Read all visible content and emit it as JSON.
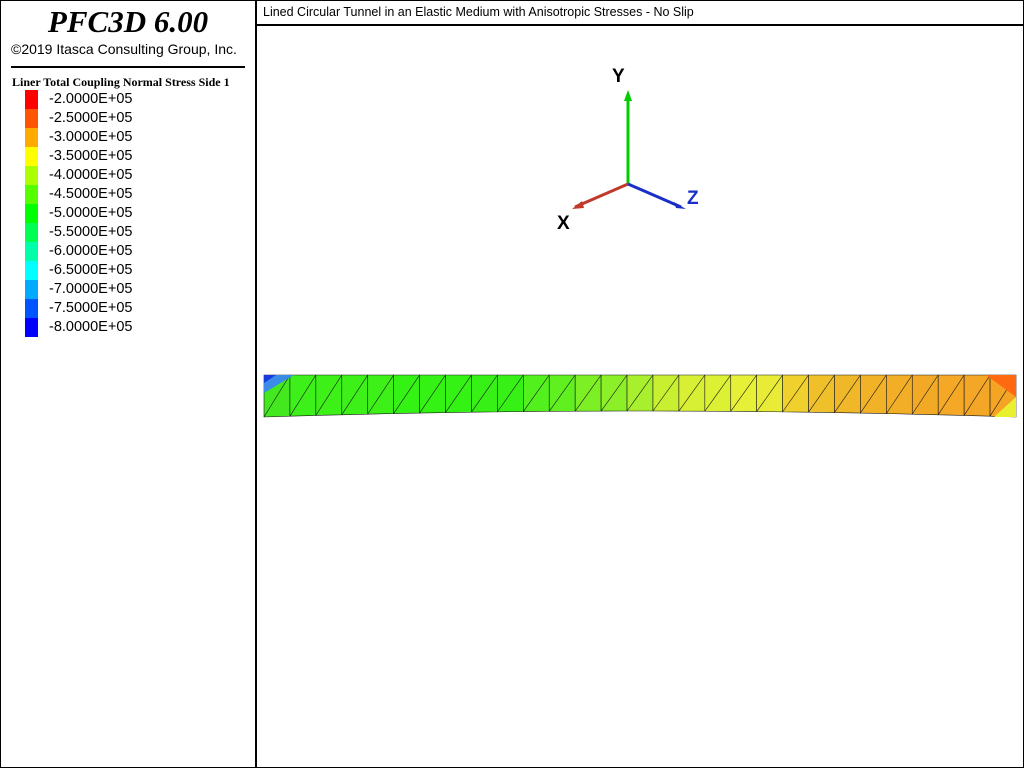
{
  "app": {
    "title": "PFC3D 6.00",
    "copyright": "©2019 Itasca Consulting Group, Inc."
  },
  "legend": {
    "title": "Liner Total Coupling Normal Stress Side 1",
    "items": [
      {
        "label": "-2.0000E+05",
        "color": "#ff0000"
      },
      {
        "label": "-2.5000E+05",
        "color": "#ff5500"
      },
      {
        "label": "-3.0000E+05",
        "color": "#ffaa00"
      },
      {
        "label": "-3.5000E+05",
        "color": "#ffff00"
      },
      {
        "label": "-4.0000E+05",
        "color": "#aaff00"
      },
      {
        "label": "-4.5000E+05",
        "color": "#55ff00"
      },
      {
        "label": "-5.0000E+05",
        "color": "#00ff00"
      },
      {
        "label": "-5.5000E+05",
        "color": "#00ff55"
      },
      {
        "label": "-6.0000E+05",
        "color": "#00ffaa"
      },
      {
        "label": "-6.5000E+05",
        "color": "#00ffff"
      },
      {
        "label": "-7.0000E+05",
        "color": "#00aaff"
      },
      {
        "label": "-7.5000E+05",
        "color": "#0055ff"
      },
      {
        "label": "-8.0000E+05",
        "color": "#0000ff"
      }
    ]
  },
  "plot": {
    "title": "Lined Circular Tunnel in an Elastic Medium with Anisotropic Stresses - No Slip"
  },
  "axes": {
    "x_label": "X",
    "y_label": "Y",
    "z_label": "Z",
    "x_color": "#c0392b",
    "y_color": "#00cc00",
    "z_color": "#1a2fc8"
  },
  "liner_colors": [
    "#44e81e",
    "#3ef01a",
    "#3cf018",
    "#3cf018",
    "#3cf018",
    "#34f214",
    "#34f214",
    "#34f214",
    "#36f016",
    "#36f016",
    "#52f01c",
    "#60f020",
    "#7cf024",
    "#8cf028",
    "#a8f02e",
    "#c8f030",
    "#d8f034",
    "#dcf034",
    "#e6f036",
    "#e8ec36",
    "#f0d02c",
    "#f0c02a",
    "#f0b828",
    "#f2b228",
    "#f2ae26",
    "#f2aa26",
    "#f4a826",
    "#f4a626",
    "#f5a424"
  ]
}
